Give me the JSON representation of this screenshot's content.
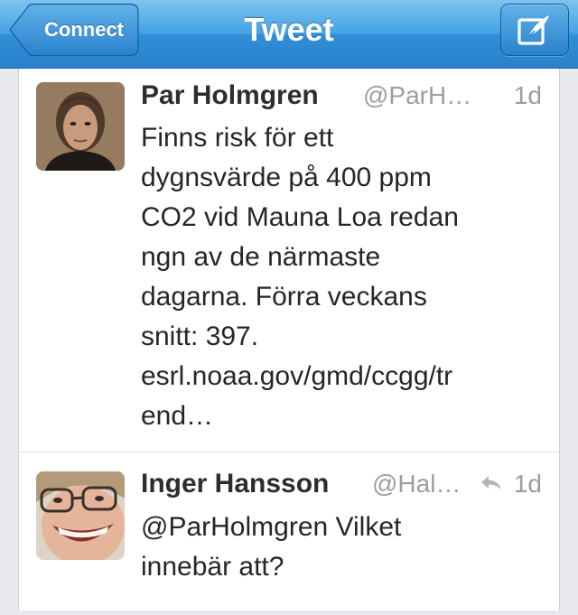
{
  "navbar": {
    "back_label": "Connect",
    "title": "Tweet",
    "compose_icon": "compose-icon"
  },
  "colors": {
    "nav_blue": "#2f8fd6",
    "name_text": "#2d2d2d",
    "meta_text": "#9a9ea3"
  },
  "tweets": [
    {
      "name": "Par Holmgren",
      "handle": "@ParH…",
      "time": "1d",
      "lines": [
        "Finns risk för ett",
        "dygnsvärde på 400 ppm",
        "CO2 vid Mauna Loa redan",
        "ngn av de närmaste",
        "dagarna. Förra veckans",
        "snitt: 397.",
        "esrl.noaa.gov/gmd/ccgg/tr",
        "end…"
      ]
    },
    {
      "name": "Inger Hansson",
      "handle": "@Hal…",
      "time": "1d",
      "reply_icon": "reply-arrow-icon",
      "lines": [
        "@ParHolmgren Vilket",
        "innebär att?"
      ]
    }
  ]
}
